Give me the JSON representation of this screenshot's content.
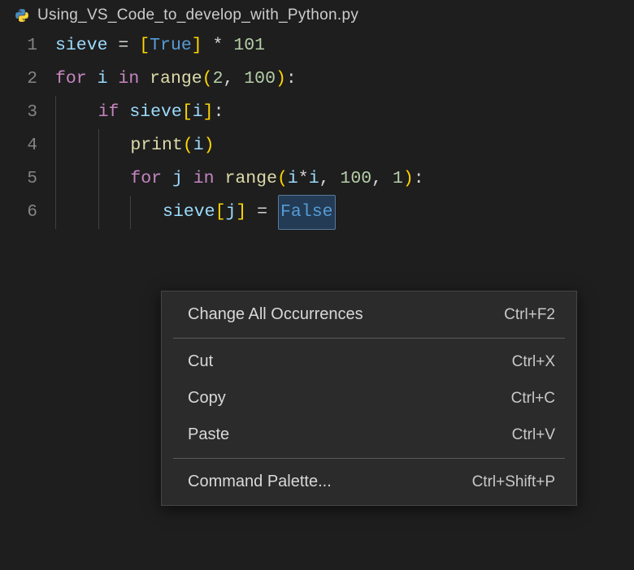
{
  "tab": {
    "filename": "Using_VS_Code_to_develop_with_Python.py",
    "icon": "python-icon"
  },
  "code": {
    "lines": [
      {
        "num": "1",
        "indent": 0
      },
      {
        "num": "2",
        "indent": 0
      },
      {
        "num": "3",
        "indent": 1
      },
      {
        "num": "4",
        "indent": 2
      },
      {
        "num": "5",
        "indent": 2
      },
      {
        "num": "6",
        "indent": 3
      }
    ],
    "tokens": {
      "l1": {
        "var": "sieve",
        "eq": " = ",
        "lb": "[",
        "true": "True",
        "rb": "]",
        "mul": " * ",
        "n101": "101"
      },
      "l2": {
        "for": "for",
        "sp": " ",
        "i": "i",
        "in": " in ",
        "range": "range",
        "lp": "(",
        "n2": "2",
        "c": ", ",
        "n100": "100",
        "rp": ")",
        "col": ":"
      },
      "l3": {
        "if": "if",
        "sp": " ",
        "sieve": "sieve",
        "lb": "[",
        "i": "i",
        "rb": "]",
        "col": ":"
      },
      "l4": {
        "print": "print",
        "lp": "(",
        "i": "i",
        "rp": ")"
      },
      "l5": {
        "for": "for",
        "sp": " ",
        "j": "j",
        "in": " in ",
        "range": "range",
        "lp": "(",
        "i1": "i",
        "star": "*",
        "i2": "i",
        "c1": ", ",
        "n100": "100",
        "c2": ", ",
        "n1": "1",
        "rp": ")",
        "col": ":"
      },
      "l6": {
        "sieve": "sieve",
        "lb": "[",
        "j": "j",
        "rb": "]",
        "eq": " = ",
        "false": "False"
      }
    }
  },
  "context_menu": {
    "items": [
      {
        "label": "Change All Occurrences",
        "shortcut": "Ctrl+F2"
      },
      {
        "sep": true
      },
      {
        "label": "Cut",
        "shortcut": "Ctrl+X"
      },
      {
        "label": "Copy",
        "shortcut": "Ctrl+C"
      },
      {
        "label": "Paste",
        "shortcut": "Ctrl+V"
      },
      {
        "sep": true
      },
      {
        "label": "Command Palette...",
        "shortcut": "Ctrl+Shift+P"
      }
    ]
  }
}
